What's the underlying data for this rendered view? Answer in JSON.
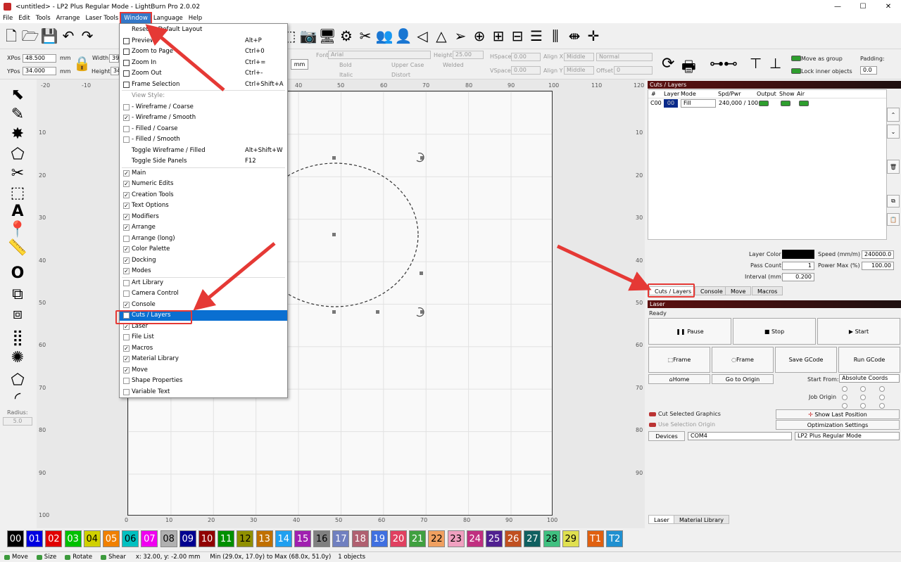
{
  "window": {
    "title": "<untitled> - LP2 Plus Regular Mode - LightBurn Pro 2.0.02",
    "min": "—",
    "max": "☐",
    "close": "✕"
  },
  "menubar": [
    "File",
    "Edit",
    "Tools",
    "Arrange",
    "Laser Tools",
    "Window",
    "Language",
    "Help"
  ],
  "toolbar_icons": [
    "new-file-icon",
    "open-folder-icon",
    "save-icon",
    "undo-icon",
    "redo-icon",
    "frame-select-icon",
    "camera-icon",
    "monitor-icon",
    "settings-icon",
    "tools-icon",
    "group-icon",
    "user-icon",
    "mirror-icon",
    "flip-icon",
    "send-icon",
    "target-icon",
    "align-icon",
    "distribute-icon",
    "h-distribute-icon",
    "v-distribute-icon",
    "move-icon"
  ],
  "numeric": {
    "xpos_label": "XPos",
    "xpos": "48.500",
    "ypos_label": "YPos",
    "ypos": "34.000",
    "unit": "mm",
    "width_label": "Width",
    "width": "39",
    "height_label": "Height",
    "height": "34",
    "mm_btn": "mm"
  },
  "text_opts": {
    "font_label": "Font",
    "font": "Arial",
    "height_label": "Height",
    "height": "25.00",
    "hspace_label": "HSpace",
    "hspace": "0.00",
    "vspace_label": "VSpace",
    "vspace": "0.00",
    "alignx_label": "Align X",
    "alignx": "Middle",
    "aligny_label": "Align Y",
    "aligny": "Middle",
    "normal": "Normal",
    "offset_label": "Offset",
    "offset": "0",
    "bold": "Bold",
    "italic": "Italic",
    "upper": "Upper Case",
    "distort": "Distort",
    "welded": "Welded"
  },
  "grouping": {
    "move_as_group": "Move as group",
    "lock_inner": "Lock inner objects",
    "padding_label": "Padding:",
    "padding": "0.0"
  },
  "radius": {
    "label": "Radius:",
    "value": "5.0"
  },
  "ruler_top": [
    "-20",
    "-10",
    "0",
    "10",
    "20",
    "30",
    "40",
    "50",
    "60",
    "70",
    "80",
    "90",
    "100",
    "110",
    "120"
  ],
  "ruler_left": [
    "10",
    "20",
    "30",
    "40",
    "50",
    "60",
    "70",
    "80",
    "90",
    "100"
  ],
  "ruler_right": [
    "10",
    "20",
    "30",
    "40",
    "50",
    "60",
    "70",
    "80",
    "90"
  ],
  "ruler_bottom": [
    "0",
    "10",
    "20",
    "30",
    "40",
    "50",
    "60",
    "70",
    "80",
    "90",
    "100"
  ],
  "ruler_corner": [
    "-20",
    "0",
    "120",
    "100"
  ],
  "window_menu": {
    "items": [
      {
        "label": "Reset to Default Layout",
        "key": "",
        "cb": "none"
      },
      {
        "label": "Preview",
        "key": "Alt+P",
        "cb": "icon"
      },
      {
        "label": "Zoom to Page",
        "key": "Ctrl+0",
        "cb": "icon"
      },
      {
        "label": "Zoom In",
        "key": "Ctrl+=",
        "cb": "icon"
      },
      {
        "label": "Zoom Out",
        "key": "Ctrl+-",
        "cb": "icon"
      },
      {
        "label": "Frame Selection",
        "key": "Ctrl+Shift+A",
        "cb": "icon"
      },
      {
        "label": "View Style:",
        "key": "",
        "cb": "none",
        "gray": true
      },
      {
        "label": "-  Wireframe / Coarse",
        "key": "",
        "cb": "off"
      },
      {
        "label": "-  Wireframe / Smooth",
        "key": "",
        "cb": "on"
      },
      {
        "label": "-  Filled / Coarse",
        "key": "",
        "cb": "off"
      },
      {
        "label": "-  Filled / Smooth",
        "key": "",
        "cb": "off"
      },
      {
        "label": "Toggle Wireframe / Filled",
        "key": "Alt+Shift+W",
        "cb": "none"
      },
      {
        "label": "Toggle Side Panels",
        "key": "F12",
        "cb": "none"
      },
      {
        "label": "Main",
        "key": "",
        "cb": "on"
      },
      {
        "label": "Numeric Edits",
        "key": "",
        "cb": "on"
      },
      {
        "label": "Creation Tools",
        "key": "",
        "cb": "on"
      },
      {
        "label": "Text Options",
        "key": "",
        "cb": "on"
      },
      {
        "label": "Modifiers",
        "key": "",
        "cb": "on"
      },
      {
        "label": "Arrange",
        "key": "",
        "cb": "on"
      },
      {
        "label": "Arrange (long)",
        "key": "",
        "cb": "off"
      },
      {
        "label": "Color Palette",
        "key": "",
        "cb": "on"
      },
      {
        "label": "Docking",
        "key": "",
        "cb": "on"
      },
      {
        "label": "Modes",
        "key": "",
        "cb": "on"
      },
      {
        "label": "Art Library",
        "key": "",
        "cb": "off"
      },
      {
        "label": "Camera Control",
        "key": "",
        "cb": "off"
      },
      {
        "label": "Console",
        "key": "",
        "cb": "on"
      },
      {
        "label": "Cuts / Layers",
        "key": "",
        "cb": "on",
        "hl": true
      },
      {
        "label": "Laser",
        "key": "",
        "cb": "on"
      },
      {
        "label": "File List",
        "key": "",
        "cb": "off"
      },
      {
        "label": "Macros",
        "key": "",
        "cb": "on"
      },
      {
        "label": "Material Library",
        "key": "",
        "cb": "on"
      },
      {
        "label": "Move",
        "key": "",
        "cb": "on"
      },
      {
        "label": "Shape Properties",
        "key": "",
        "cb": "off"
      },
      {
        "label": "Variable Text",
        "key": "",
        "cb": "off"
      }
    ]
  },
  "cuts": {
    "title": "Cuts / Layers",
    "cols": [
      "#",
      "Layer",
      "Mode",
      "Spd/Pwr",
      "Output",
      "Show",
      "Air"
    ],
    "row": {
      "num": "C00",
      "layer": "00",
      "mode": "Fill",
      "spdpwr": "240,000 / 100"
    },
    "layer_color_label": "Layer Color",
    "speed_label": "Speed (mm/m)",
    "speed": "240000.0",
    "pass_label": "Pass Count",
    "pass": "1",
    "power_label": "Power Max (%)",
    "power": "100.00",
    "interval_label": "Interval (mm)",
    "interval": "0.200",
    "tabs": [
      "Cuts / Layers",
      "Console",
      "Move",
      "Macros"
    ]
  },
  "laser": {
    "title": "Laser",
    "status": "Ready",
    "pause": "Pause",
    "stop": "Stop",
    "start": "Start",
    "frame1": "Frame",
    "frame2": "Frame",
    "save_gcode": "Save GCode",
    "run_gcode": "Run GCode",
    "home": "Home",
    "go_origin": "Go to Origin",
    "start_from_label": "Start From:",
    "start_from": "Absolute Coords",
    "job_origin_label": "Job Origin",
    "cut_selected": "Cut Selected Graphics",
    "use_sel_origin": "Use Selection Origin",
    "show_last": "Show Last Position",
    "opt_settings": "Optimization Settings",
    "devices": "Devices",
    "port": "COM4",
    "device": "LP2 Plus Regular Mode",
    "tabs": [
      "Laser",
      "Material Library"
    ]
  },
  "palette": [
    {
      "l": "00",
      "c": "#000000"
    },
    {
      "l": "01",
      "c": "#0000e0"
    },
    {
      "l": "02",
      "c": "#e00000"
    },
    {
      "l": "03",
      "c": "#00c000"
    },
    {
      "l": "04",
      "c": "#d0d000"
    },
    {
      "l": "05",
      "c": "#f08000"
    },
    {
      "l": "06",
      "c": "#00c0c0"
    },
    {
      "l": "07",
      "c": "#f000f0"
    },
    {
      "l": "08",
      "c": "#b0b0b0"
    },
    {
      "l": "09",
      "c": "#000090"
    },
    {
      "l": "10",
      "c": "#900000"
    },
    {
      "l": "11",
      "c": "#009000"
    },
    {
      "l": "12",
      "c": "#909000"
    },
    {
      "l": "13",
      "c": "#c07000"
    },
    {
      "l": "14",
      "c": "#20a0f0"
    },
    {
      "l": "15",
      "c": "#a020b0"
    },
    {
      "l": "16",
      "c": "#808080"
    },
    {
      "l": "17",
      "c": "#7080c0"
    },
    {
      "l": "18",
      "c": "#b06070"
    },
    {
      "l": "19",
      "c": "#4070e0"
    },
    {
      "l": "20",
      "c": "#e04060"
    },
    {
      "l": "21",
      "c": "#40a040"
    },
    {
      "l": "22",
      "c": "#f0a060"
    },
    {
      "l": "23",
      "c": "#f0a0c0"
    },
    {
      "l": "24",
      "c": "#c03080"
    },
    {
      "l": "25",
      "c": "#502090"
    },
    {
      "l": "26",
      "c": "#c05020"
    },
    {
      "l": "27",
      "c": "#106060"
    },
    {
      "l": "28",
      "c": "#40c080"
    },
    {
      "l": "29",
      "c": "#e0e050"
    },
    {
      "l": "T1",
      "c": "#e06010"
    },
    {
      "l": "T2",
      "c": "#2090d0"
    }
  ],
  "status": {
    "move": "Move",
    "size": "Size",
    "rotate": "Rotate",
    "shear": "Shear",
    "coords": "x: 32.00, y: -2.00 mm",
    "range": "Min (29.0x, 17.0y) to Max (68.0x, 51.0y)",
    "objects": "1 objects"
  },
  "accent": "#e53935"
}
